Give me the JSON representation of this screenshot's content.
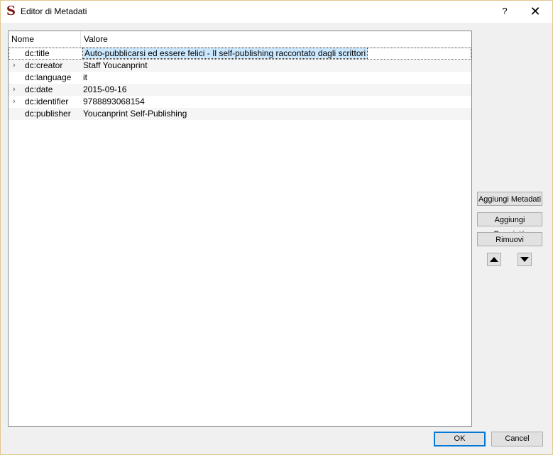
{
  "window": {
    "title": "Editor di Metadati",
    "help_label": "?",
    "close_label": "✕"
  },
  "tree": {
    "columns": [
      "Nome",
      "Valore"
    ],
    "rows": [
      {
        "name": "dc:title",
        "value": "Auto-pubblicarsi ed essere felici - Il self-publishing raccontato dagli scrittori",
        "expandable": false,
        "selected": true
      },
      {
        "name": "dc:creator",
        "value": "Staff Youcanprint",
        "expandable": true,
        "selected": false
      },
      {
        "name": "dc:language",
        "value": "it",
        "expandable": false,
        "selected": false
      },
      {
        "name": "dc:date",
        "value": "2015-09-16",
        "expandable": true,
        "selected": false
      },
      {
        "name": "dc:identifier",
        "value": "9788893068154",
        "expandable": true,
        "selected": false
      },
      {
        "name": "dc:publisher",
        "value": "Youcanprint Self-Publishing",
        "expandable": false,
        "selected": false
      }
    ]
  },
  "side_buttons": {
    "add_metadata": "Aggiungi Metadati",
    "add_property": "Aggiungi Proprietà",
    "remove": "Rimuovi"
  },
  "dialog_buttons": {
    "ok": "OK",
    "cancel": "Cancel"
  },
  "icons": {
    "app": "sigil-s-icon",
    "expander": "chevron-right-icon",
    "move_up": "triangle-up-icon",
    "move_down": "triangle-down-icon"
  },
  "colors": {
    "selection": "#cce8ff",
    "default_button_border": "#0078d7",
    "app_icon": "#7a1a14"
  }
}
